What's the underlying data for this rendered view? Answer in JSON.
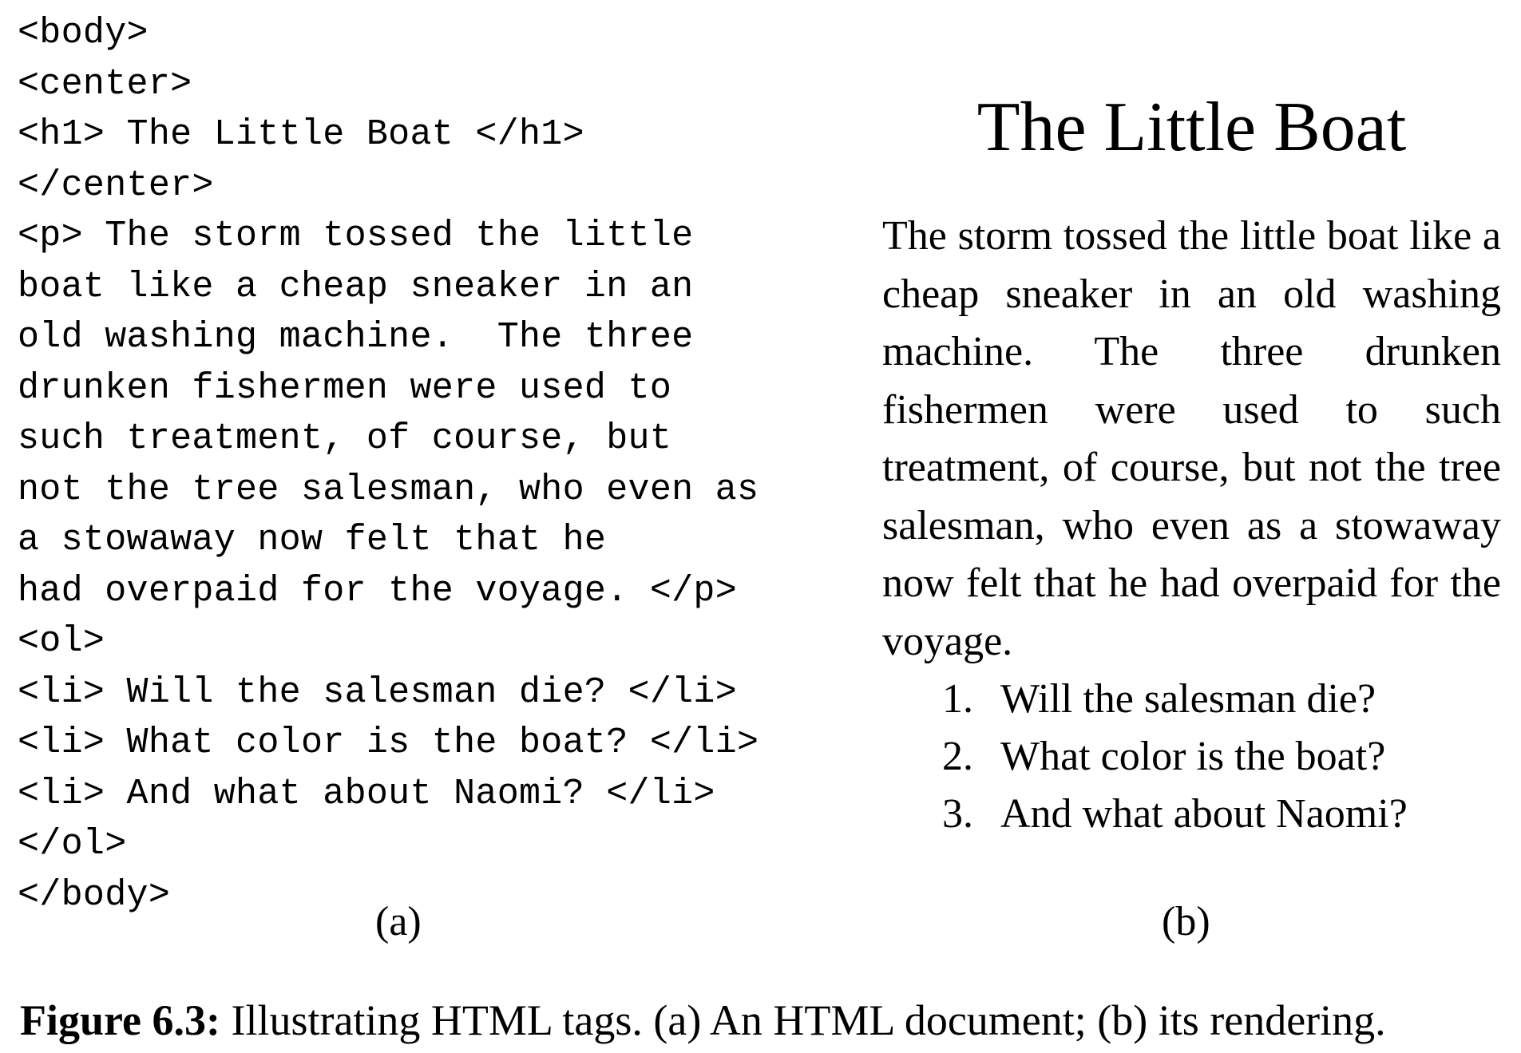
{
  "code_lines": [
    "<body>",
    "<center>",
    "<h1> The Little Boat </h1>",
    "</center>",
    "<p> The storm tossed the little",
    "boat like a cheap sneaker in an",
    "old washing machine.  The three",
    "drunken fishermen were used to",
    "such treatment, of course, but",
    "not the tree salesman, who even as",
    "a stowaway now felt that he",
    "had overpaid for the voyage. </p>",
    "<ol>",
    "<li> Will the salesman die? </li>",
    "<li> What color is the boat? </li>",
    "<li> And what about Naomi? </li>",
    "</ol>",
    "</body>"
  ],
  "rendered": {
    "title": "The Little Boat",
    "paragraph": "The storm tossed the little boat like a cheap sneaker in an old washing machine. The three drunken fishermen were used to such treatment, of course, but not the tree salesman, who even as a stowaway now felt that he had overpaid for the voyage.",
    "list": [
      {
        "num": "1.",
        "text": "Will the salesman die?"
      },
      {
        "num": "2.",
        "text": "What color is the boat?"
      },
      {
        "num": "3.",
        "text": "And what about Naomi?"
      }
    ]
  },
  "panel_labels": {
    "a": "(a)",
    "b": "(b)"
  },
  "caption": {
    "label": "Figure 6.3:",
    "text": " Illustrating HTML tags. (a) An HTML document; (b) its rendering."
  }
}
